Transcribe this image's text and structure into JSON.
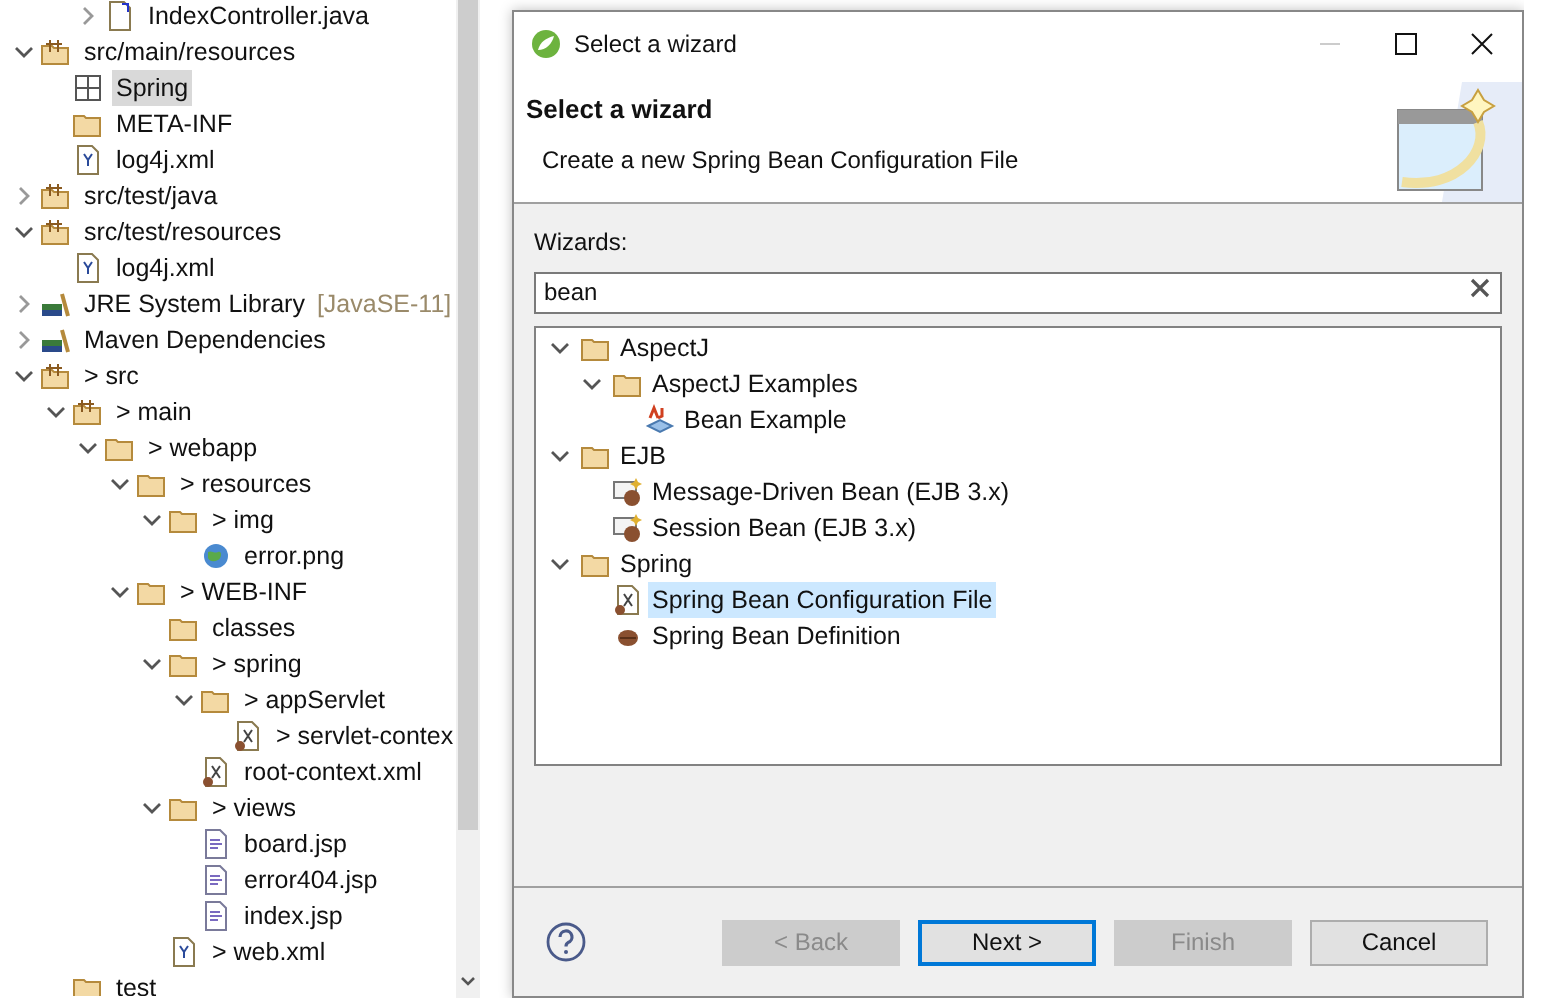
{
  "partial_top_item": {
    "label": "IndexController.java",
    "kind": "java",
    "expanded": false
  },
  "project_tree": [
    {
      "label": "src/main/resources",
      "kind": "package",
      "expanded": true,
      "children": [
        {
          "label": "Spring",
          "kind": "spring",
          "selected": true
        },
        {
          "label": "META-INF",
          "kind": "folder"
        },
        {
          "label": "log4j.xml",
          "kind": "xml"
        }
      ]
    },
    {
      "label": "src/test/java",
      "kind": "package",
      "expanded": false
    },
    {
      "label": "src/test/resources",
      "kind": "package",
      "expanded": true,
      "children": [
        {
          "label": "log4j.xml",
          "kind": "xml"
        }
      ]
    },
    {
      "label": "JRE System Library",
      "decoration": "[JavaSE-11]",
      "kind": "library",
      "expanded": false
    },
    {
      "label": "Maven Dependencies",
      "kind": "library",
      "expanded": false
    },
    {
      "label": "> src",
      "kind": "package",
      "expanded": true,
      "children": [
        {
          "label": "> main",
          "kind": "package",
          "expanded": true,
          "children": [
            {
              "label": "> webapp",
              "kind": "folder",
              "expanded": true,
              "children": [
                {
                  "label": "> resources",
                  "kind": "folder",
                  "expanded": true,
                  "children": [
                    {
                      "label": "> img",
                      "kind": "folder",
                      "expanded": true,
                      "children": [
                        {
                          "label": "error.png",
                          "kind": "image"
                        }
                      ]
                    }
                  ]
                },
                {
                  "label": "> WEB-INF",
                  "kind": "folder",
                  "expanded": true,
                  "children": [
                    {
                      "label": "classes",
                      "kind": "folder"
                    },
                    {
                      "label": "> spring",
                      "kind": "folder",
                      "expanded": true,
                      "children": [
                        {
                          "label": "> appServlet",
                          "kind": "folder",
                          "expanded": true,
                          "children": [
                            {
                              "label": "> servlet-contex",
                              "kind": "beans"
                            }
                          ]
                        },
                        {
                          "label": "root-context.xml",
                          "kind": "beans"
                        }
                      ]
                    },
                    {
                      "label": "> views",
                      "kind": "folder",
                      "expanded": true,
                      "children": [
                        {
                          "label": "board.jsp",
                          "kind": "jsp"
                        },
                        {
                          "label": "error404.jsp",
                          "kind": "jsp"
                        },
                        {
                          "label": "index.jsp",
                          "kind": "jsp"
                        }
                      ]
                    },
                    {
                      "label": "> web.xml",
                      "kind": "xml"
                    }
                  ]
                }
              ]
            }
          ]
        },
        {
          "label": "test",
          "kind": "folder"
        }
      ]
    }
  ],
  "dialog": {
    "title": "Select a wizard",
    "heading": "Select a wizard",
    "description": "Create a new Spring Bean Configuration File",
    "filter_label": "Wizards:",
    "filter_value": "bean",
    "wizards": [
      {
        "label": "AspectJ",
        "kind": "folder",
        "expanded": true,
        "selected": false,
        "children": [
          {
            "label": "AspectJ Examples",
            "kind": "folder",
            "expanded": true,
            "selected": false,
            "children": [
              {
                "label": "Bean Example",
                "kind": "aspectj",
                "selected": false
              }
            ]
          }
        ]
      },
      {
        "label": "EJB",
        "kind": "folder",
        "expanded": true,
        "selected": false,
        "children": [
          {
            "label": "Message-Driven Bean (EJB 3.x)",
            "kind": "ejb",
            "selected": false
          },
          {
            "label": "Session Bean (EJB 3.x)",
            "kind": "ejb",
            "selected": false
          }
        ]
      },
      {
        "label": "Spring",
        "kind": "folder",
        "expanded": true,
        "selected": false,
        "children": [
          {
            "label": "Spring Bean Configuration File",
            "kind": "beans",
            "selected": true
          },
          {
            "label": "Spring Bean Definition",
            "kind": "bean",
            "selected": false
          }
        ]
      }
    ],
    "buttons": [
      {
        "label": "< Back",
        "disabled": true,
        "default": false
      },
      {
        "label": "Next >",
        "disabled": false,
        "default": true
      },
      {
        "label": "Finish",
        "disabled": true,
        "default": false
      },
      {
        "label": "Cancel",
        "disabled": false,
        "default": false
      }
    ]
  }
}
